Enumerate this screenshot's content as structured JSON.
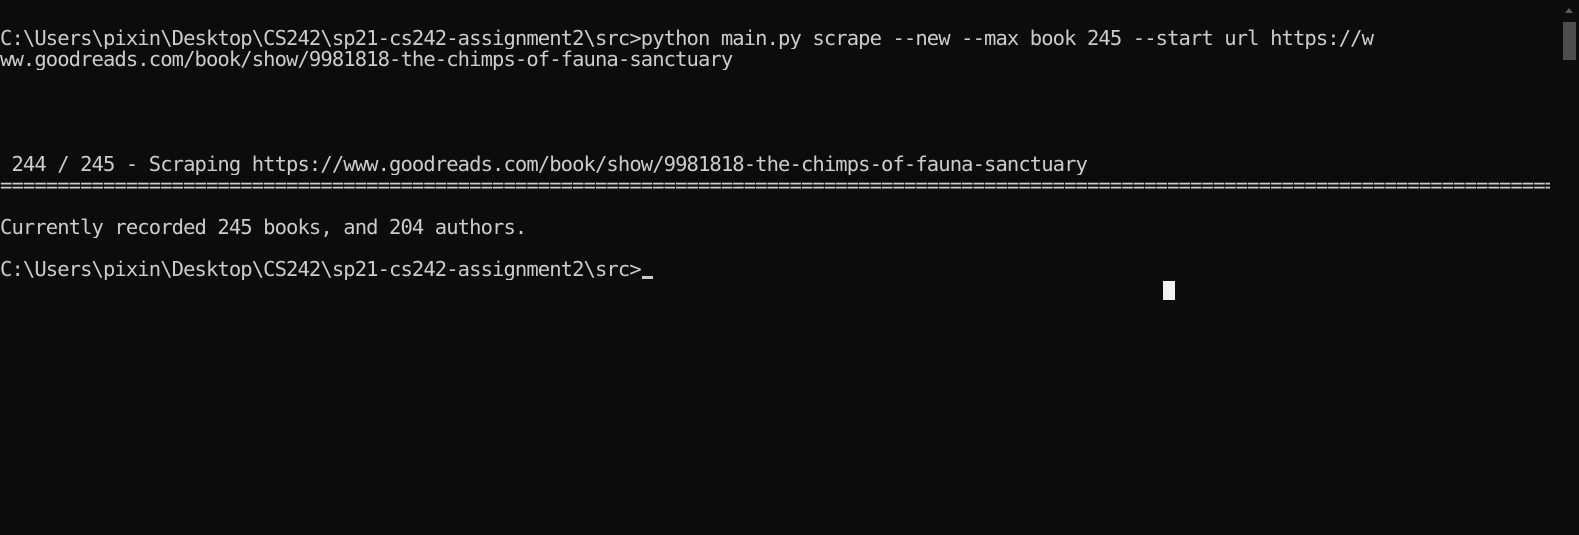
{
  "terminal": {
    "lines": [
      "C:\\Users\\pixin\\Desktop\\CS242\\sp21-cs242-assignment2\\src>python main.py scrape --new --max_book 245 --start_url https://w",
      "ww.goodreads.com/book/show/9981818-the-chimps-of-fauna-sanctuary",
      "",
      "",
      "",
      "",
      " 244 / 245 - Scraping https://www.goodreads.com/book/show/9981818-the-chimps-of-fauna-sanctuary",
      "==============================================================================================================================================",
      "",
      "Currently recorded 245 books, and 204 authors.",
      "",
      "C:\\Users\\pixin\\Desktop\\CS242\\sp21-cs242-assignment2\\src>"
    ]
  },
  "colors": {
    "background": "#0c0c0c",
    "foreground": "#cccccc",
    "cursor": "#f2f2f2"
  }
}
